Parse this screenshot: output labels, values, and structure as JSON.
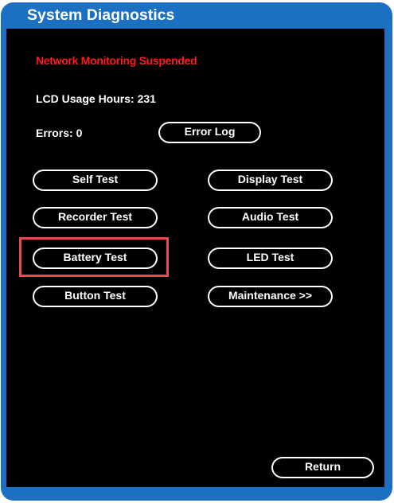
{
  "window": {
    "title": "System Diagnostics"
  },
  "status": {
    "network_warning": "Network Monitoring Suspended",
    "lcd_usage": "LCD Usage Hours: 231",
    "errors": "Errors: 0"
  },
  "buttons": {
    "error_log": "Error Log",
    "self_test": "Self Test",
    "display_test": "Display Test",
    "recorder_test": "Recorder Test",
    "audio_test": "Audio Test",
    "battery_test": "Battery Test",
    "led_test": "LED Test",
    "button_test": "Button Test",
    "maintenance": "Maintenance >>",
    "return": "Return"
  },
  "colors": {
    "frame": "#1c70c4",
    "panel": "#000000",
    "warning": "#ff1a1a",
    "highlight": "#e8494f"
  }
}
